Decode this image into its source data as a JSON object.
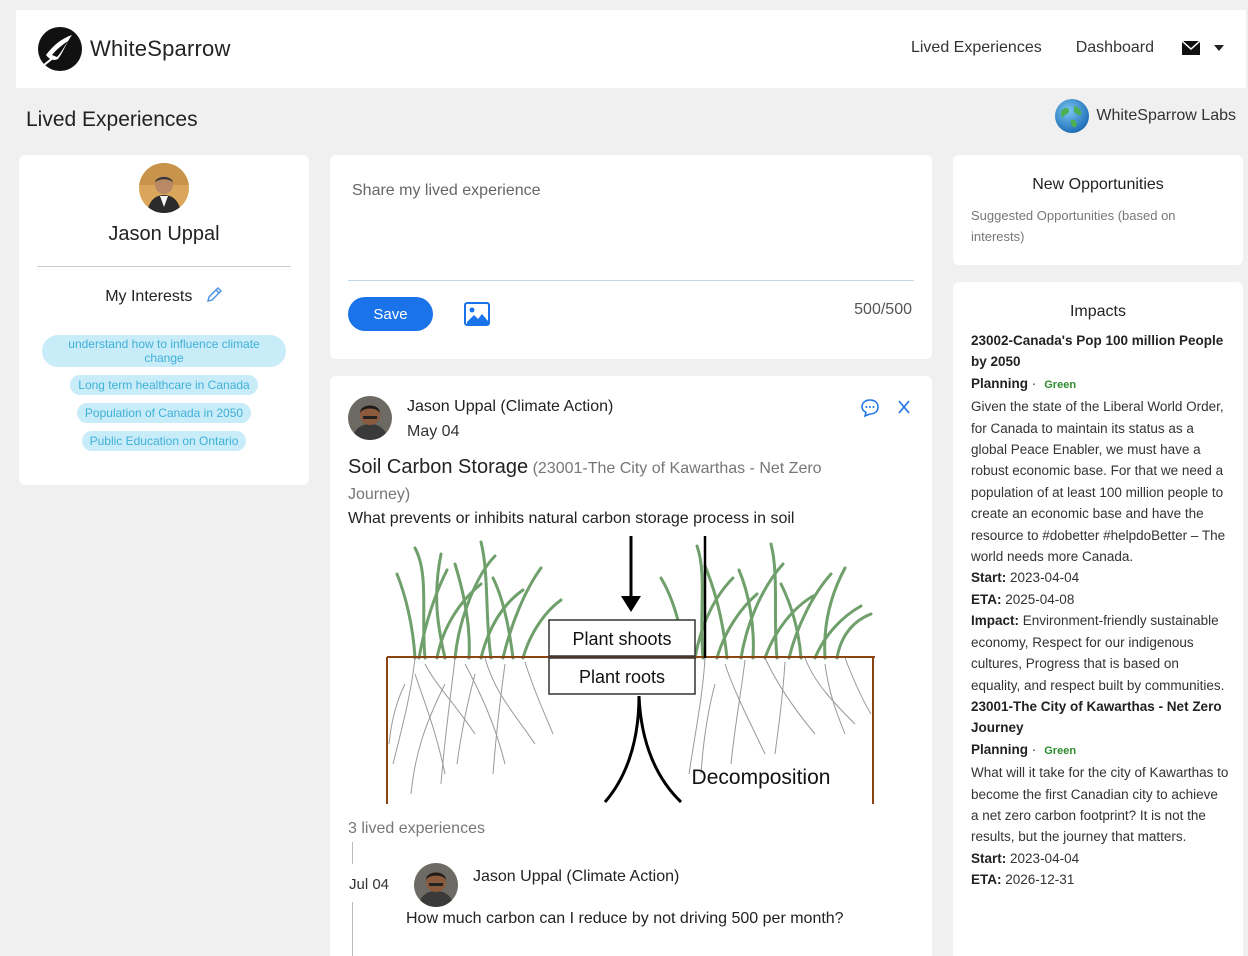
{
  "brand": {
    "name": "WhiteSparrow"
  },
  "nav": {
    "items": [
      "Lived Experiences",
      "Dashboard"
    ]
  },
  "page": {
    "title": "Lived Experiences",
    "labs": "WhiteSparrow Labs"
  },
  "profile": {
    "name": "Jason Uppal",
    "interests_title": "My Interests",
    "interests": [
      "understand how to influence climate change",
      "Long term healthcare in Canada",
      "Population of Canada in 2050",
      "Public Education on Ontario"
    ]
  },
  "compose": {
    "placeholder": "Share my lived experience",
    "save_label": "Save",
    "counter": "500/500"
  },
  "post": {
    "author": "Jason Uppal (Climate Action)",
    "date": "May 04",
    "title": "Soil Carbon Storage",
    "subtitle": "(23001-The City of Kawarthas - Net Zero Journey)",
    "description": "What prevents or inhibits natural carbon storage process in soil",
    "diagram": {
      "shoots": "Plant shoots",
      "roots": "Plant roots",
      "decomposition": "Decomposition"
    },
    "lived_count": "3 lived experiences",
    "reply": {
      "date": "Jul 04",
      "author": "Jason Uppal (Climate Action)",
      "text": "How much carbon can I reduce by not driving 500 per month?"
    }
  },
  "opportunities": {
    "title": "New Opportunities",
    "subtitle": "Suggested Opportunities (based on interests)"
  },
  "impacts": {
    "title": "Impacts",
    "start_label": "Start:",
    "eta_label": "ETA:",
    "impact_label": "Impact:",
    "items": [
      {
        "name": "23002-Canada's Pop 100 million People by 2050",
        "status": "Planning",
        "badge": "Green",
        "description": "Given the state of the Liberal World Order, for Canada to maintain its status as a global Peace Enabler, we must have a robust economic base. For that we need a population of at least 100 million people to create an economic base and have the resource to #dobetter #helpdoBetter – The world needs more Canada.",
        "start": "2023-04-04",
        "eta": "2025-04-08",
        "impact": "Environment-friendly sustainable economy, Respect for our indigenous cultures, Progress that is based on equality, and respect built by communities."
      },
      {
        "name": "23001-The City of Kawarthas - Net Zero Journey",
        "status": "Planning",
        "badge": "Green",
        "description": "What will it take for the city of Kawarthas to become the first Canadian city to achieve a net zero carbon footprint? It is not the results, but the journey that matters.",
        "start": "2023-04-04",
        "eta": "2026-12-31"
      }
    ]
  },
  "colors": {
    "primary": "#1a73e8",
    "tag_bg": "#c8ecf8",
    "tag_text": "#3fb0d8",
    "green": "#2e8b2e"
  }
}
